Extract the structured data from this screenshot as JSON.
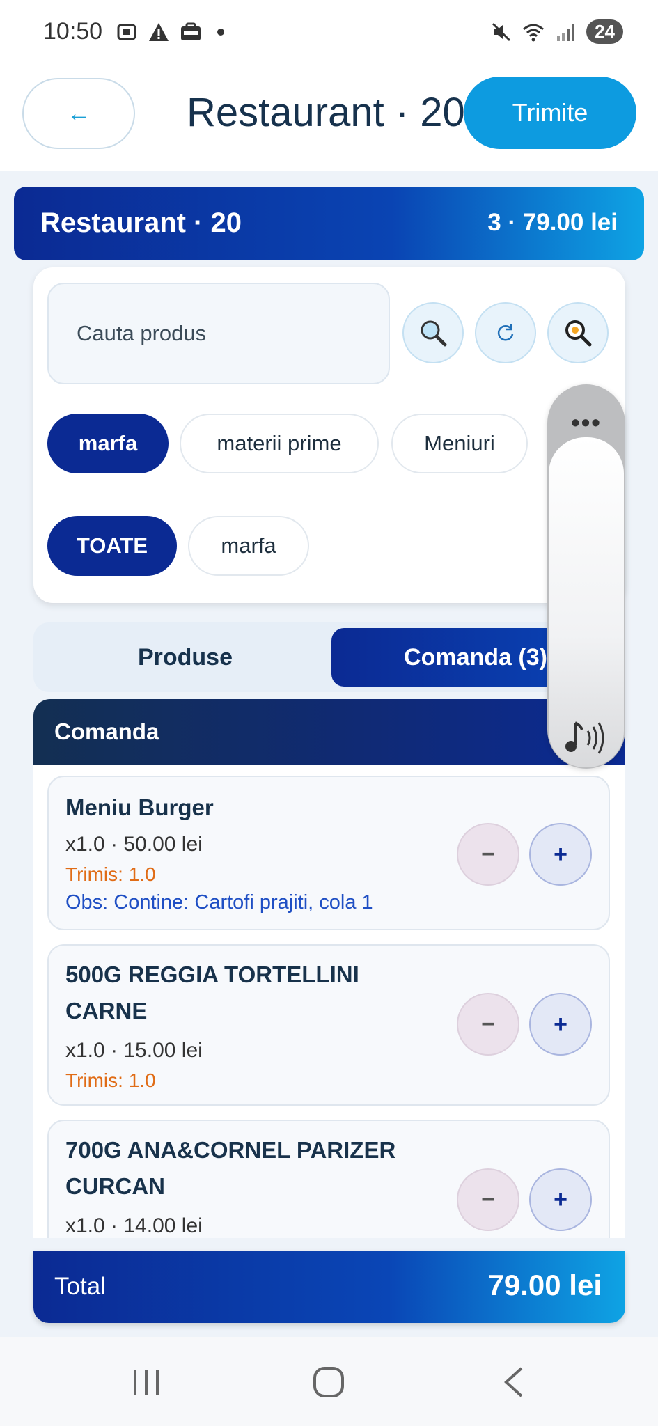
{
  "status_bar": {
    "time": "10:50",
    "battery": "24",
    "icons_left": [
      "screenshot-icon",
      "warning-icon",
      "emag-icon",
      "dot-icon"
    ],
    "icons_right": [
      "mute-icon",
      "wifi-icon",
      "signal-icon",
      "battery-icon"
    ]
  },
  "header": {
    "back_label": "←",
    "title": "Restaurant · 20",
    "send_label": "Trimite"
  },
  "banner": {
    "title": "Restaurant · 20",
    "summary": "3 · 79.00 lei"
  },
  "search": {
    "placeholder": "Cauta produs"
  },
  "icon_buttons": [
    "search-icon",
    "refresh-icon",
    "scan-icon"
  ],
  "categories": [
    {
      "label": "marfa",
      "active": true
    },
    {
      "label": "materii prime",
      "active": false
    },
    {
      "label": "Meniuri",
      "active": false
    }
  ],
  "subcategories": [
    {
      "label": "TOATE",
      "active": true
    },
    {
      "label": "marfa",
      "active": false
    }
  ],
  "tabs": {
    "produse": "Produse",
    "comanda": "Comanda (3)"
  },
  "order": {
    "title": "Comanda",
    "items": [
      {
        "name_lines": [
          "Meniu Burger"
        ],
        "qty_price": "x1.0  ·  50.00 lei",
        "sent": "Trimis: 1.0",
        "obs": "Obs: Contine: Cartofi prajiti, cola 1"
      },
      {
        "name_lines": [
          "500G REGGIA TORTELLINI",
          "CARNE"
        ],
        "qty_price": "x1.0  ·  15.00 lei",
        "sent": "Trimis: 1.0",
        "obs": ""
      },
      {
        "name_lines": [
          "700G ANA&CORNEL PARIZER",
          "CURCAN"
        ],
        "qty_price": "x1.0  ·  14.00 lei",
        "sent": "",
        "obs": ""
      }
    ],
    "minus_label": "−",
    "plus_label": "+"
  },
  "total": {
    "label": "Total",
    "value": "79.00 lei"
  },
  "side_panel": {
    "menu_label": "•••"
  },
  "colors": {
    "primary": "#0b2a93",
    "accent": "#0d9be0",
    "sent": "#e06c16",
    "obs": "#1f4fc4"
  }
}
